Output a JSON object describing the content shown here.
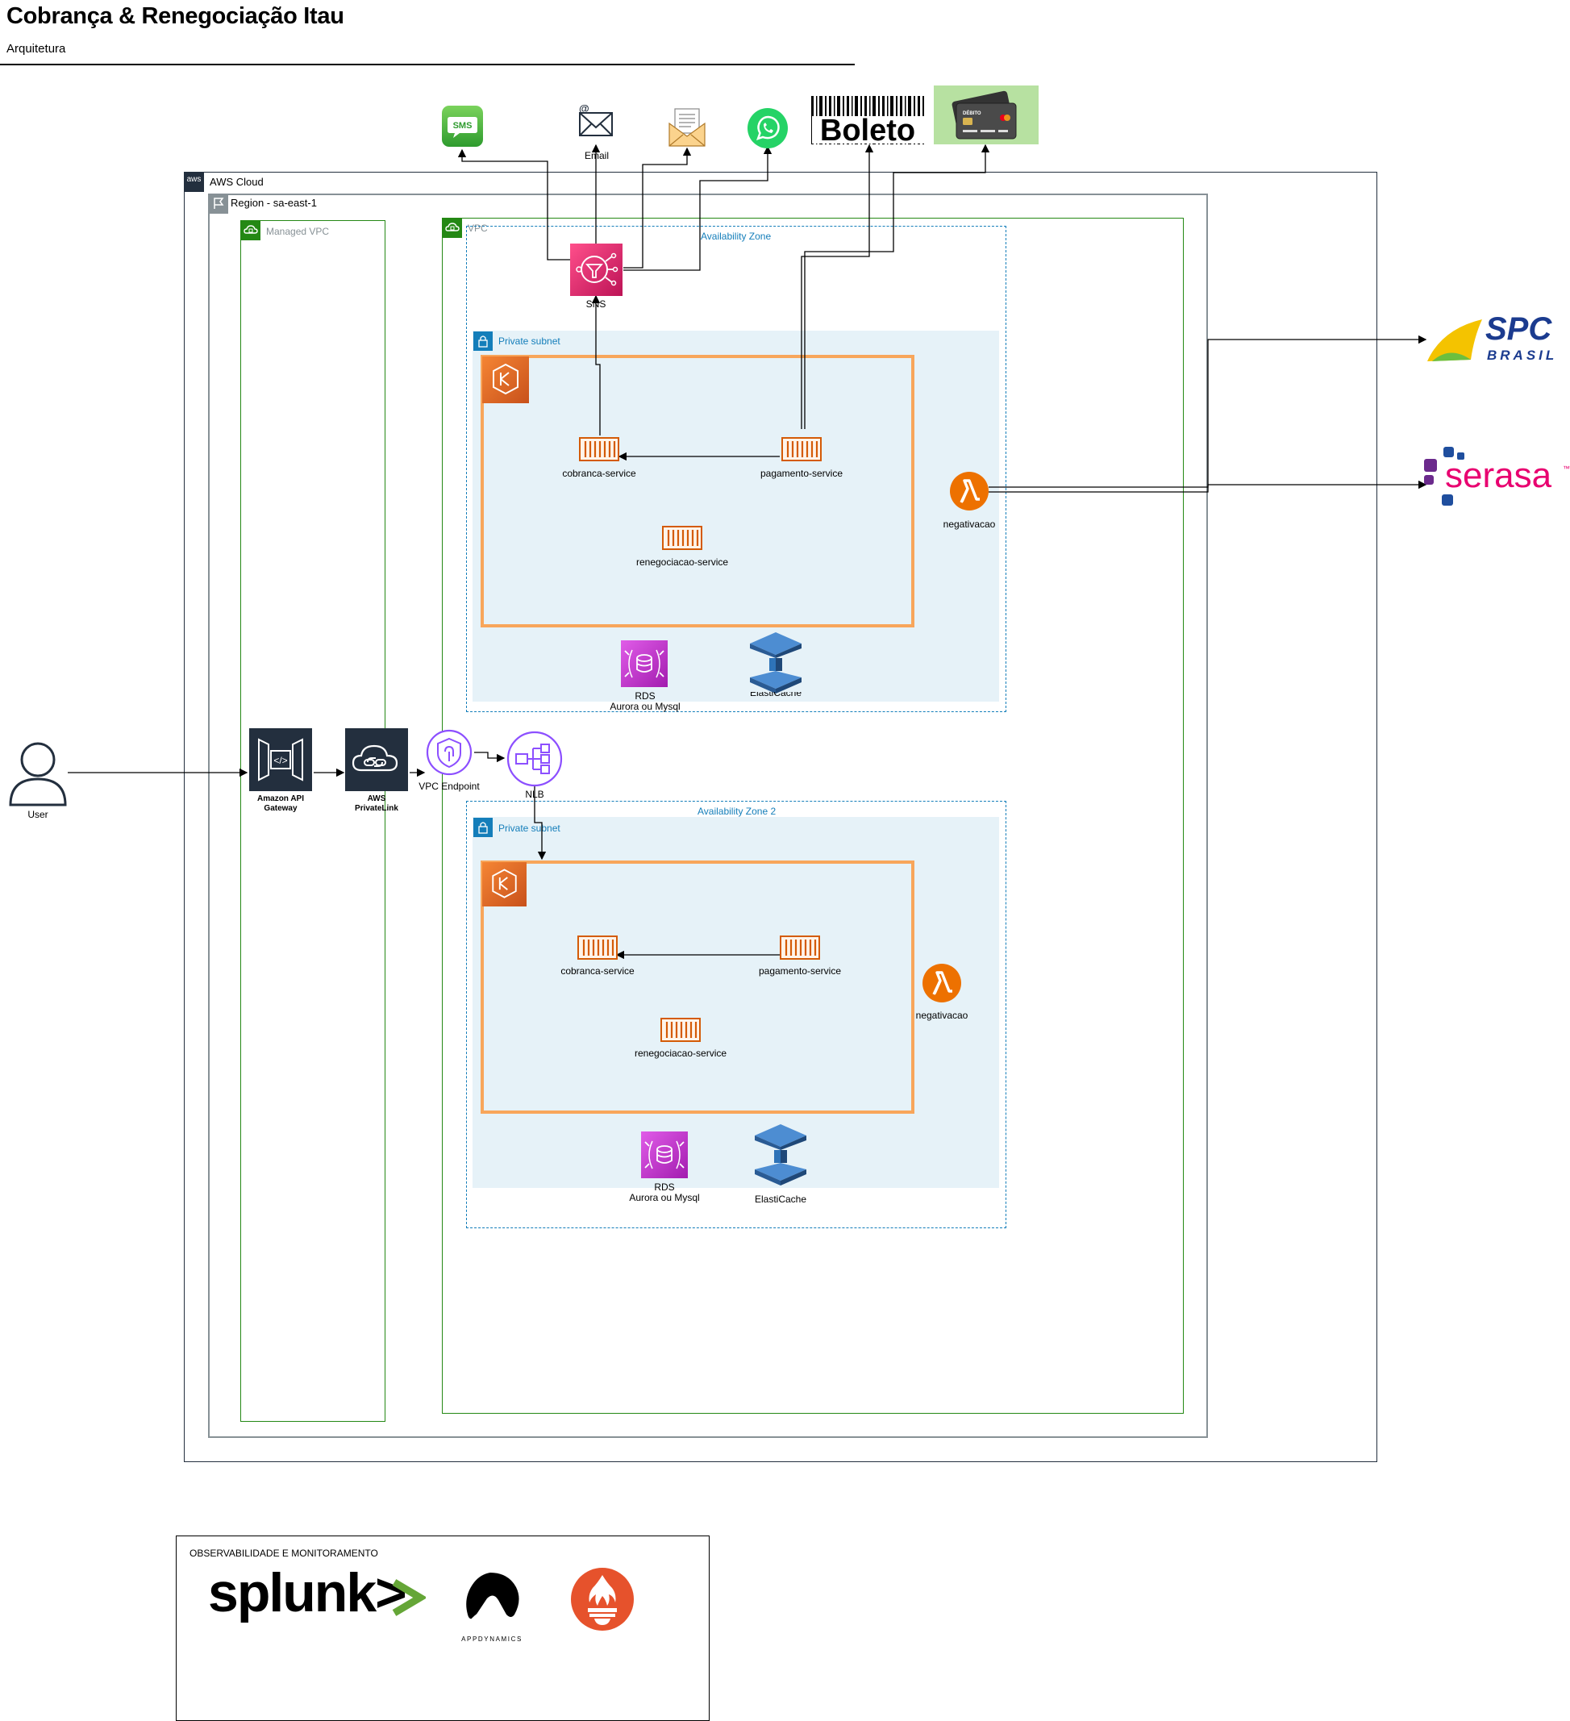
{
  "header": {
    "title": "Cobrança & Renegociação Itau",
    "subtitle": "Arquitetura"
  },
  "icons": {
    "sms": "SMS",
    "boleto": "Boleto",
    "aws_badge": "aws",
    "card_text": "DÉBITO"
  },
  "groups": {
    "aws_cloud": "AWS Cloud",
    "region": "Region - sa-east-1",
    "managed_vpc": "Managed VPC",
    "vpc": "VPC",
    "az1": "Availability Zone",
    "az2": "Availability Zone 2",
    "private_subnet_1": "Private subnet",
    "private_subnet_2": "Private subnet"
  },
  "nodes": {
    "email": "Email",
    "sns": "SNS",
    "user": "User",
    "api_gateway": "Amazon API Gateway",
    "api_gateway_line1": "Amazon API",
    "api_gateway_line2": "Gateway",
    "privatelink_line1": "AWS",
    "privatelink_line2": "PrivateLink",
    "vpc_endpoint": "VPC Endpoint",
    "nlb": "NLB",
    "cobranca_1": "cobranca-service",
    "pagamento_1": "pagamento-service",
    "renegociacao_1": "renegociacao-service",
    "negativacao_1": "negativacao",
    "rds_1_line1": "RDS",
    "rds_1_line2": "Aurora ou Mysql",
    "elasticache_1": "ElastiCache",
    "cobranca_2": "cobranca-service",
    "pagamento_2": "pagamento-service",
    "renegociacao_2": "renegociacao-service",
    "negativacao_2": "negativacao",
    "rds_2_line1": "RDS",
    "rds_2_line2": "Aurora ou Mysql",
    "elasticache_2": "ElastiCache"
  },
  "external": {
    "spc_line1": "SPC",
    "spc_line2": "BRASIL",
    "serasa": "serasa",
    "serasa_tm": "™"
  },
  "observability": {
    "title": "OBSERVABILIDADE E MONITORAMENTO",
    "splunk": "splunk>",
    "appdynamics": "APPDYNAMICS"
  },
  "colors": {
    "aws_cloud_border": "#232F3E",
    "region_border": "#879196",
    "vpc_border": "#248814",
    "az_border": "#147EBA",
    "subnet_fill": "#E6F2F8",
    "ecs_border": "#F8A65B",
    "ecs_icon": "#D45B07",
    "sns": "#E7157B",
    "nlb_purple": "#8C4FFF",
    "rds": "#C925D1",
    "elasticache": "#2E73B8",
    "lambda": "#ED7100",
    "whatsapp": "#25D366",
    "sms_green": "#4CAF50",
    "card_bg": "#B7E1A1",
    "serasa_pink": "#E80070",
    "spc_blue": "#1B3B8F",
    "spc_yellow": "#F4C300",
    "prometheus": "#E6522C"
  }
}
